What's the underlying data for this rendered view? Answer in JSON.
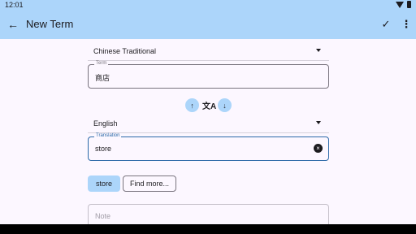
{
  "status_bar": {
    "time": "12:01"
  },
  "app_bar": {
    "title": "New Term",
    "back_icon": "arrow-back-icon",
    "save_icon": "check-icon",
    "more_icon": "more-vert-icon"
  },
  "source": {
    "language": "Chinese Traditional",
    "field_label": "Term",
    "value": "商店"
  },
  "swap": {
    "up_icon": "arrow-up-icon",
    "translate_icon": "translate-icon",
    "down_icon": "arrow-down-icon"
  },
  "target": {
    "language": "English",
    "field_label": "Translation",
    "value": "store"
  },
  "suggestions": {
    "chip": "store",
    "find_more": "Find more..."
  },
  "note": {
    "placeholder": "Note"
  },
  "colors": {
    "app_bar": "#acd5fa",
    "background": "#fcf7ff",
    "accent": "#2b69a8"
  }
}
